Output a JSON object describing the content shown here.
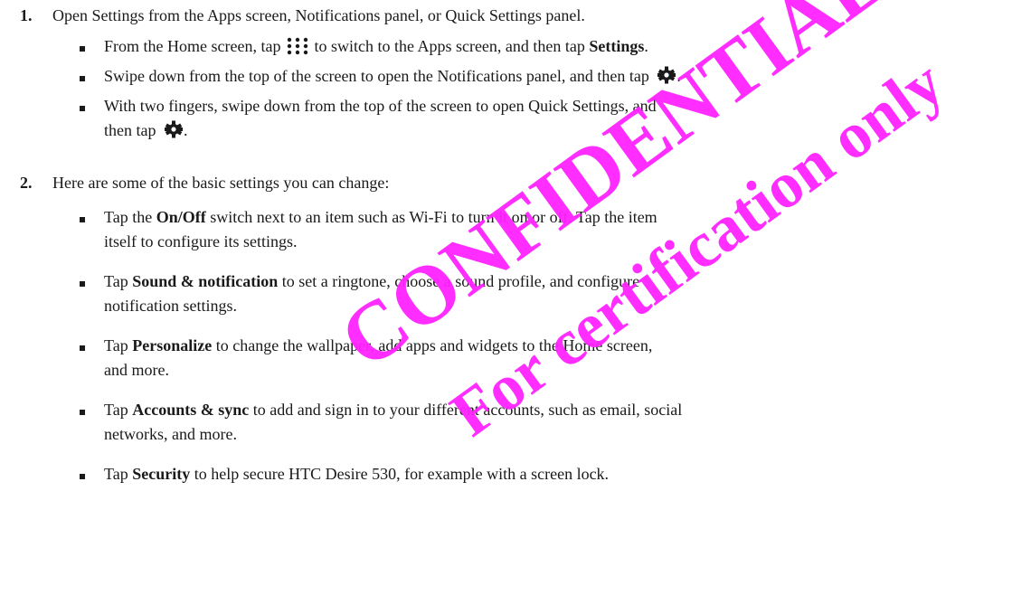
{
  "steps": [
    {
      "number": "1.",
      "text": "Open Settings from the Apps screen, Notifications panel, or Quick Settings panel.",
      "bullets": [
        {
          "pre": "From the Home screen, tap",
          "mid": "to switch to the Apps screen, and then tap",
          "bold": "Settings",
          "post": "."
        },
        {
          "pre": "Swipe down from the top of the screen to open the Notifications panel, and then tap",
          "post": "."
        },
        {
          "line1": "With two fingers, swipe down from the top of the screen to open Quick Settings, and",
          "line2_pre": "then tap",
          "line2_post": "."
        }
      ]
    },
    {
      "number": "2.",
      "text": "Here are some of the basic settings you can change:",
      "bullets": [
        {
          "pre": "Tap the",
          "bold": "On/Off",
          "post": "switch next to an item such as Wi-Fi to turn it on or off. Tap the item",
          "line2": "itself to configure its settings."
        },
        {
          "pre": "Tap",
          "bold": "Sound & notification",
          "post": "to set a ringtone, choose a sound profile, and configure",
          "line2": "notification settings."
        },
        {
          "pre": "Tap",
          "bold": "Personalize",
          "post": "to change the wallpaper, add apps and widgets to the Home screen,",
          "line2": "and more."
        },
        {
          "pre": "Tap",
          "bold": "Accounts & sync",
          "post": "to add and sign in to your different accounts, such as email, social",
          "line2": "networks, and more."
        },
        {
          "pre": "Tap",
          "bold": "Security",
          "post": "to help secure HTC Desire 530, for example with a screen lock."
        }
      ]
    }
  ],
  "watermark": {
    "line1": "CONFIDENTIAL",
    "line2": "For certification only"
  },
  "colors": {
    "text": "#1a1a1a",
    "watermark": "#ff22ff"
  },
  "icons": {
    "apps": "apps-grid-icon",
    "settings": "gear-icon"
  }
}
